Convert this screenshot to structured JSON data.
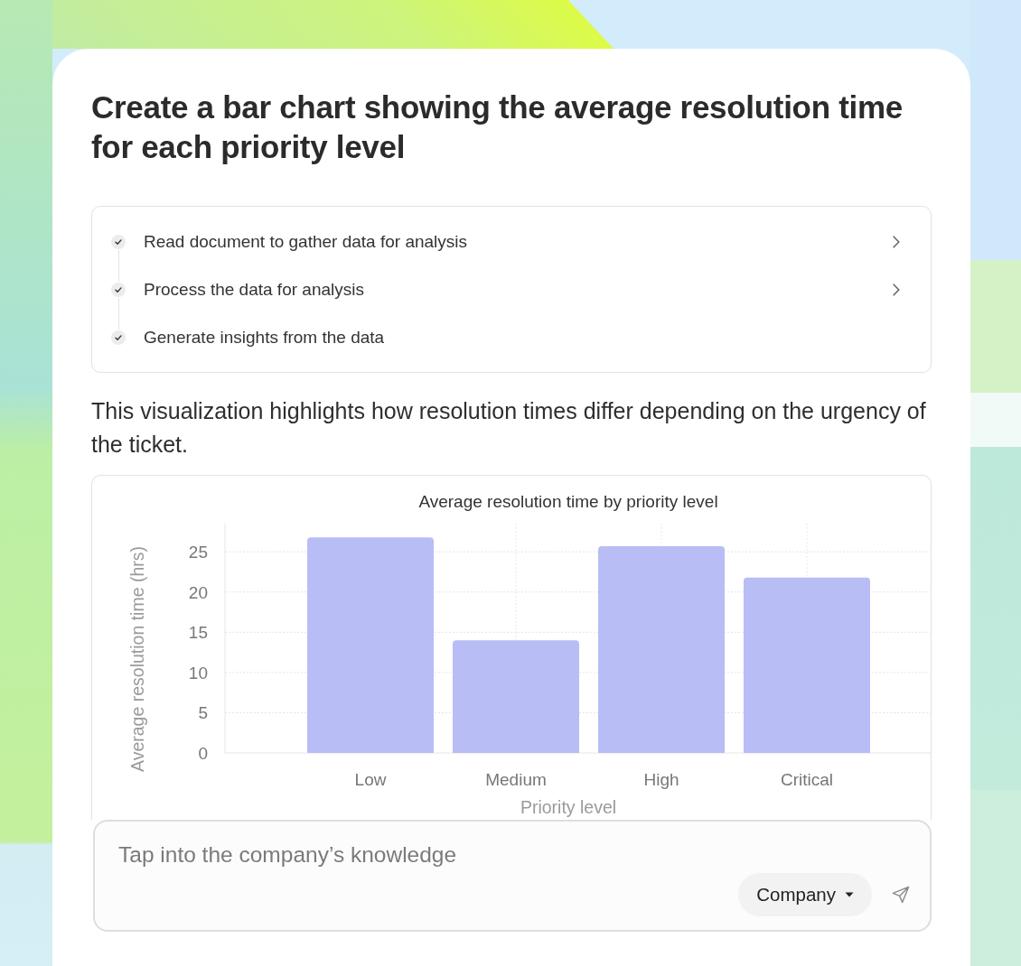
{
  "title": "Create a bar chart showing the average resolution time for each priority level",
  "steps": [
    {
      "label": "Read document to gather data for analysis",
      "done": true,
      "expandable": true
    },
    {
      "label": "Process the data for analysis",
      "done": true,
      "expandable": true
    },
    {
      "label": "Generate insights from the data",
      "done": true,
      "expandable": false
    }
  ],
  "summary": "This visualization highlights how resolution times differ depending on the urgency of the ticket.",
  "chart": {
    "chart_data": {
      "type": "bar",
      "title": "Average resolution time by priority level",
      "xlabel": "Priority level",
      "ylabel": "Average resolution time (hrs)",
      "categories": [
        "Low",
        "Medium",
        "High",
        "Critical"
      ],
      "values": [
        26.8,
        14,
        25.7,
        21.8
      ],
      "ylim": [
        0,
        28.5
      ],
      "yticks": [
        0,
        5,
        10,
        15,
        20,
        25
      ],
      "grid": true
    }
  },
  "composer": {
    "placeholder": "Tap into the company’s knowledge",
    "scope_button": "Company"
  }
}
